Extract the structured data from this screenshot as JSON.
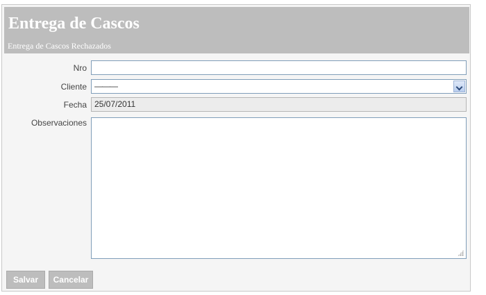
{
  "header": {
    "title": "Entrega de Cascos",
    "subtitle": "Entrega de Cascos Rechazados"
  },
  "form": {
    "nro": {
      "label": "Nro",
      "value": ""
    },
    "cliente": {
      "label": "Cliente",
      "selected": "———"
    },
    "fecha": {
      "label": "Fecha",
      "value": "25/07/2011"
    },
    "observaciones": {
      "label": "Observaciones",
      "value": ""
    }
  },
  "buttons": {
    "save_label": "Salvar",
    "cancel_label": "Cancelar"
  },
  "colors": {
    "header_bg": "#bdbdbd",
    "field_border": "#7f9db9"
  },
  "icons": {
    "dropdown": "chevron-down-icon",
    "resize": "resize-grip-icon"
  }
}
